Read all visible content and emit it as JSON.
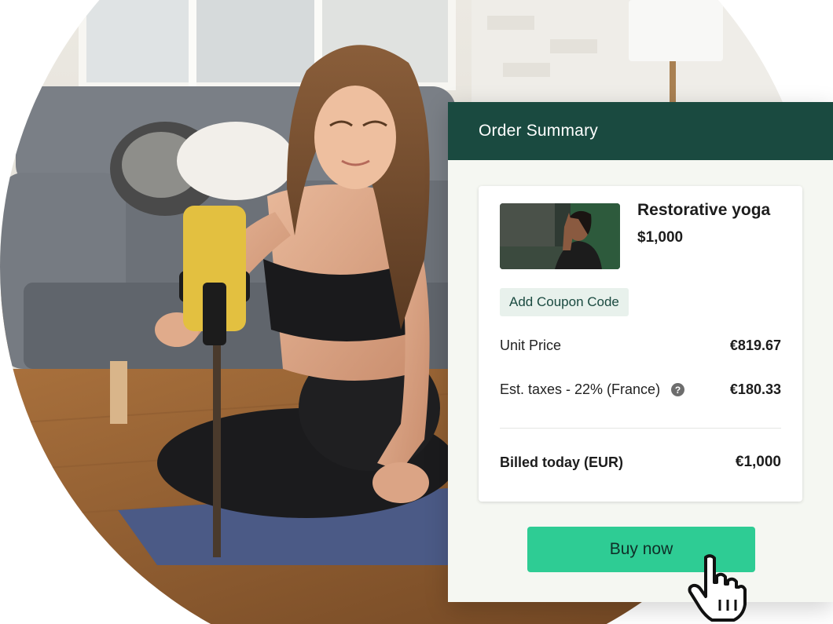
{
  "order_summary": {
    "title": "Order Summary",
    "product": {
      "name": "Restorative yoga",
      "price": "$1,000"
    },
    "coupon_label": "Add Coupon Code",
    "unit_price": {
      "label": "Unit Price",
      "value": "€819.67"
    },
    "taxes": {
      "label": "Est. taxes - 22% (France)",
      "value": "€180.33",
      "help_icon": "question-circle-icon"
    },
    "billed_today": {
      "label": "Billed today (EUR)",
      "value": "€1,000"
    },
    "buy_label": "Buy now"
  },
  "colors": {
    "header": "#1a4a40",
    "card_bg": "#f5f7f2",
    "button": "#2ecc94",
    "coupon_bg": "#e8f1ec"
  },
  "icons": {
    "pointer": "hand-pointer-icon"
  }
}
